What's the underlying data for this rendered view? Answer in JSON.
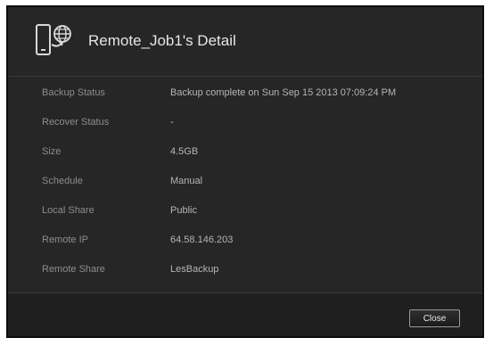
{
  "dialog": {
    "title": "Remote_Job1's Detail",
    "icon": "remote-backup-icon"
  },
  "details": {
    "rows": [
      {
        "label": "Backup Status",
        "value": "Backup complete on Sun Sep 15 2013 07:09:24 PM"
      },
      {
        "label": "Recover Status",
        "value": "-"
      },
      {
        "label": "Size",
        "value": "4.5GB"
      },
      {
        "label": "Schedule",
        "value": "Manual"
      },
      {
        "label": "Local Share",
        "value": "Public"
      },
      {
        "label": "Remote IP",
        "value": "64.58.146.203"
      },
      {
        "label": "Remote Share",
        "value": "LesBackup"
      }
    ]
  },
  "footer": {
    "close_label": "Close"
  }
}
